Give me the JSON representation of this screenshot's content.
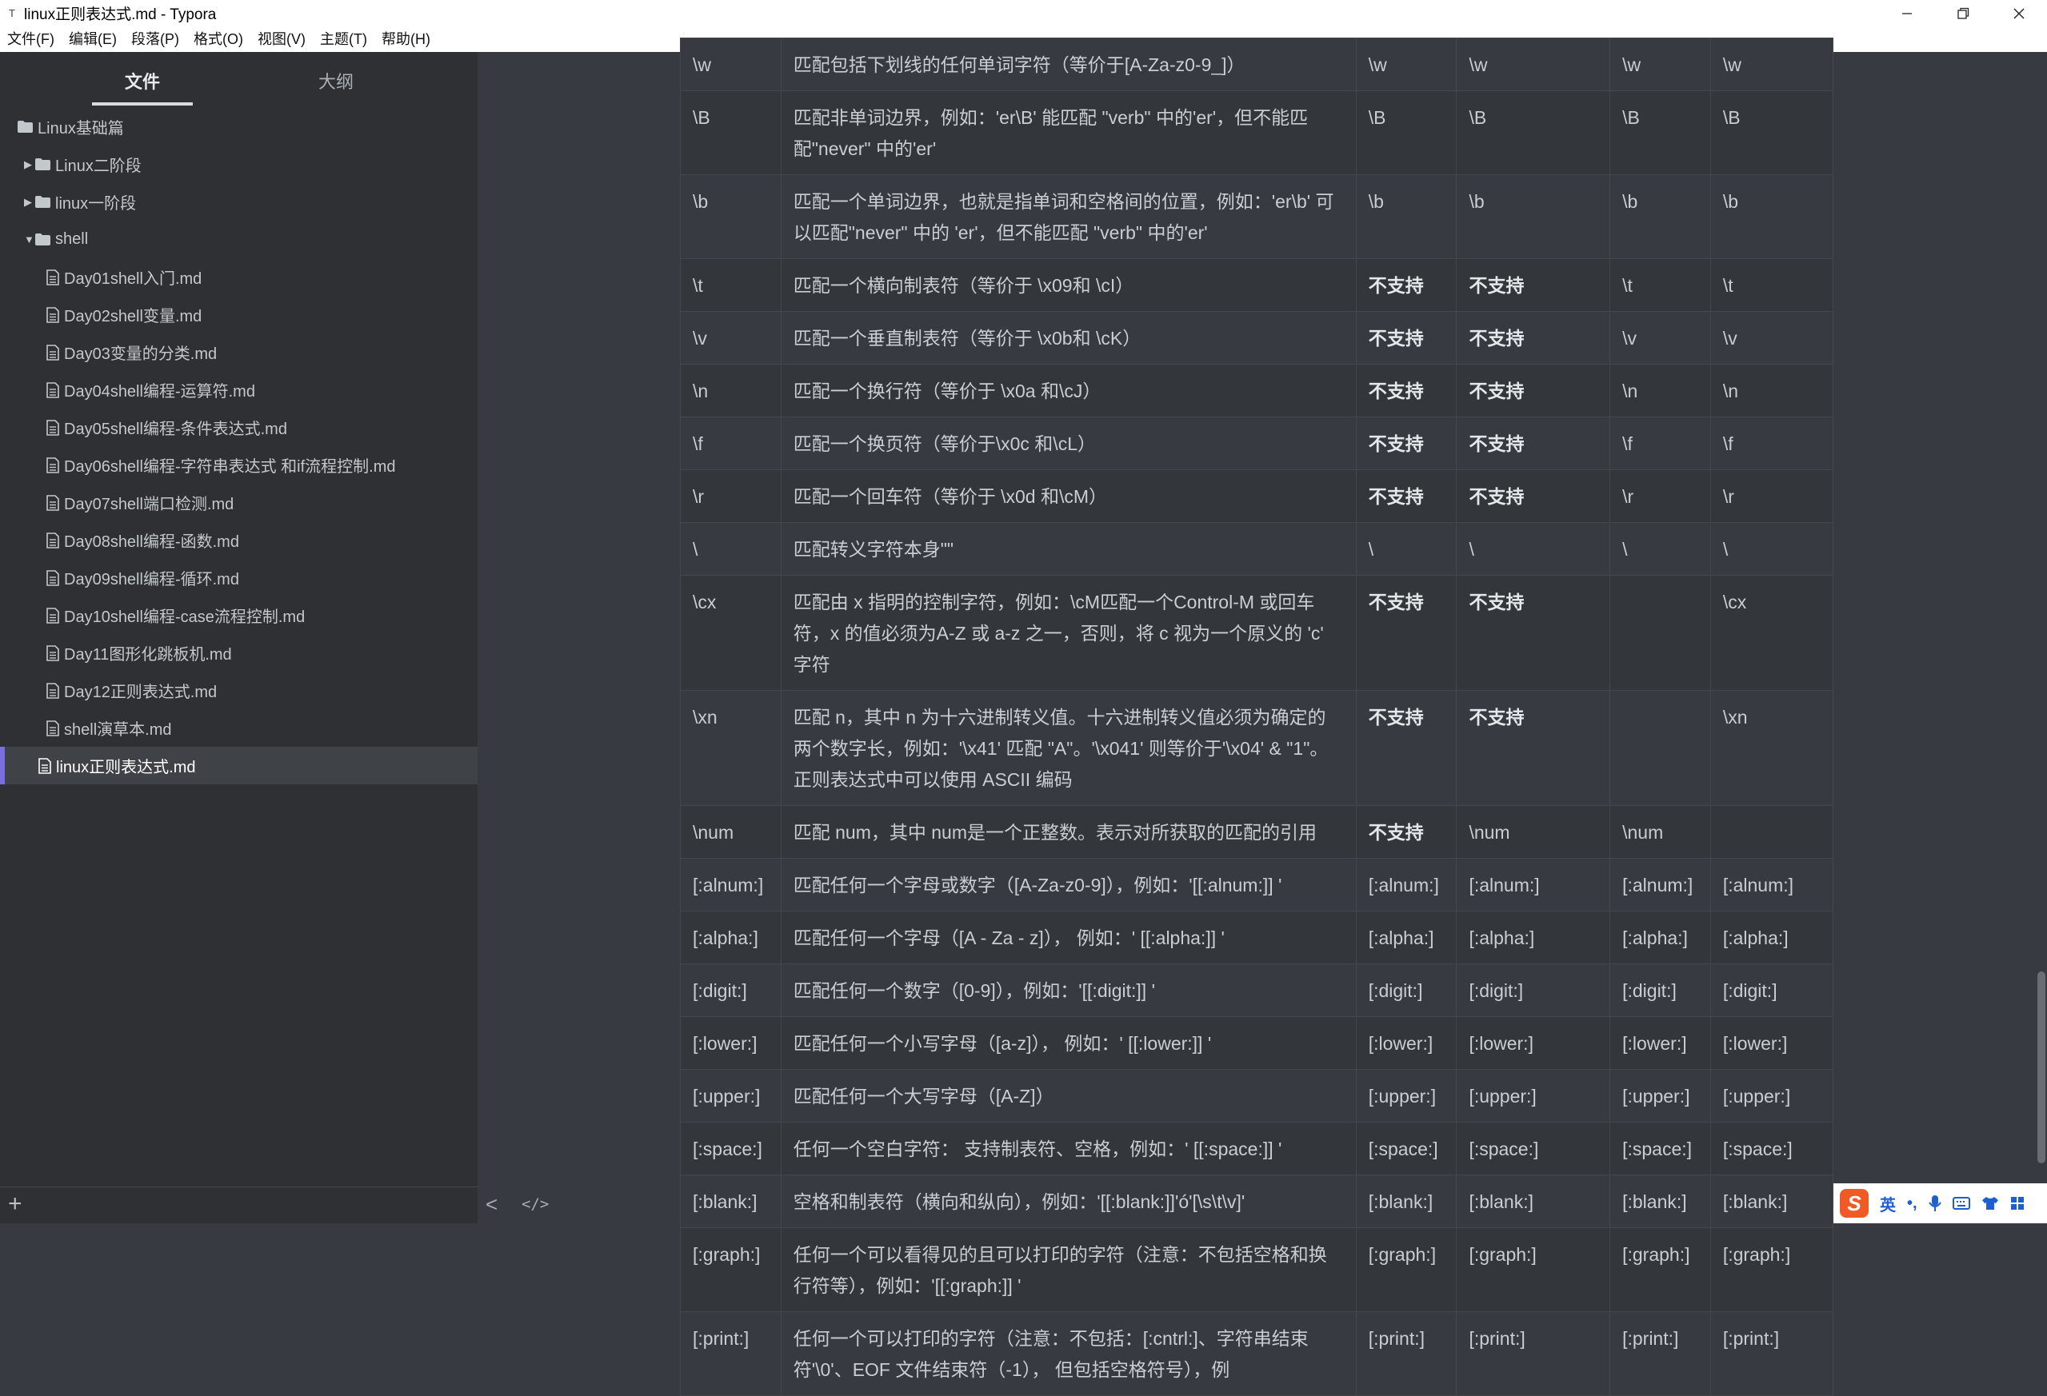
{
  "window": {
    "title": "linux正则表达式.md - Typora",
    "app_icon": "T"
  },
  "menu": [
    "文件(F)",
    "编辑(E)",
    "段落(P)",
    "格式(O)",
    "视图(V)",
    "主题(T)",
    "帮助(H)"
  ],
  "sidebar": {
    "tabs": {
      "files": "文件",
      "outline": "大纲"
    },
    "tree": [
      {
        "label": "Linux基础篇",
        "type": "folder"
      },
      {
        "label": "Linux二阶段",
        "type": "folder",
        "caret": "▶"
      },
      {
        "label": "linux一阶段",
        "type": "folder",
        "caret": "▶"
      },
      {
        "label": "shell",
        "type": "folder",
        "caret": "▼"
      },
      {
        "label": "Day01shell入门.md",
        "type": "file"
      },
      {
        "label": "Day02shell变量.md",
        "type": "file"
      },
      {
        "label": "Day03变量的分类.md",
        "type": "file"
      },
      {
        "label": "Day04shell编程-运算符.md",
        "type": "file"
      },
      {
        "label": "Day05shell编程-条件表达式.md",
        "type": "file"
      },
      {
        "label": "Day06shell编程-字符串表达式 和if流程控制.md",
        "type": "file"
      },
      {
        "label": "Day07shell端口检测.md",
        "type": "file"
      },
      {
        "label": "Day08shell编程-函数.md",
        "type": "file"
      },
      {
        "label": "Day09shell编程-循环.md",
        "type": "file"
      },
      {
        "label": "Day10shell编程-case流程控制.md",
        "type": "file"
      },
      {
        "label": "Day11图形化跳板机.md",
        "type": "file"
      },
      {
        "label": "Day12正则表达式.md",
        "type": "file"
      },
      {
        "label": "shell演草本.md",
        "type": "file"
      },
      {
        "label": "linux正则表达式.md",
        "type": "file",
        "selected": true
      }
    ],
    "add_button": "+"
  },
  "table": {
    "rows": [
      {
        "c1": "\\w",
        "c2": "匹配包括下划线的任何单词字符（等价于[A-Za-z0-9_]）",
        "c3": "\\w",
        "c4": "\\w",
        "c5": "\\w",
        "c6": "\\w"
      },
      {
        "c1": "\\B",
        "c2": "匹配非单词边界，例如：'er\\B' 能匹配 \"verb\" 中的'er'，但不能匹配\"never\" 中的'er'",
        "c3": "\\B",
        "c4": "\\B",
        "c5": "\\B",
        "c6": "\\B"
      },
      {
        "c1": "\\b",
        "c2": "匹配一个单词边界，也就是指单词和空格间的位置，例如：'er\\b' 可以匹配\"never\" 中的 'er'，但不能匹配 \"verb\" 中的'er'",
        "c3": "\\b",
        "c4": "\\b",
        "c5": "\\b",
        "c6": "\\b"
      },
      {
        "c1": "\\t",
        "c2": "匹配一个横向制表符（等价于 \\x09和 \\cI）",
        "c3": "不支持",
        "c4": "不支持",
        "c5": "\\t",
        "c6": "\\t",
        "bold3": true,
        "bold4": true
      },
      {
        "c1": "\\v",
        "c2": "匹配一个垂直制表符（等价于 \\x0b和 \\cK）",
        "c3": "不支持",
        "c4": "不支持",
        "c5": "\\v",
        "c6": "\\v",
        "bold3": true,
        "bold4": true
      },
      {
        "c1": "\\n",
        "c2": "匹配一个换行符（等价于 \\x0a 和\\cJ）",
        "c3": "不支持",
        "c4": "不支持",
        "c5": "\\n",
        "c6": "\\n",
        "bold3": true,
        "bold4": true
      },
      {
        "c1": "\\f",
        "c2": "匹配一个换页符（等价于\\x0c 和\\cL）",
        "c3": "不支持",
        "c4": "不支持",
        "c5": "\\f",
        "c6": "\\f",
        "bold3": true,
        "bold4": true
      },
      {
        "c1": "\\r",
        "c2": "匹配一个回车符（等价于 \\x0d 和\\cM）",
        "c3": "不支持",
        "c4": "不支持",
        "c5": "\\r",
        "c6": "\\r",
        "bold3": true,
        "bold4": true
      },
      {
        "c1": "\\",
        "c2": "匹配转义字符本身\"\"",
        "c3": "\\",
        "c4": "\\",
        "c5": "\\",
        "c6": "\\"
      },
      {
        "c1": "\\cx",
        "c2": "匹配由 x 指明的控制字符，例如：\\cM匹配一个Control-M 或回车符，x 的值必须为A-Z 或 a-z 之一，否则，将 c 视为一个原义的 'c' 字符",
        "c3": "不支持",
        "c4": "不支持",
        "c5": "",
        "c6": "\\cx",
        "bold3": true,
        "bold4": true
      },
      {
        "c1": "\\xn",
        "c2": "匹配 n，其中 n 为十六进制转义值。十六进制转义值必须为确定的两个数字长，例如：'\\x41' 匹配 \"A\"。'\\x041' 则等价于'\\x04' & \"1\"。正则表达式中可以使用 ASCII 编码",
        "c3": "不支持",
        "c4": "不支持",
        "c5": "",
        "c6": "\\xn",
        "bold3": true,
        "bold4": true
      },
      {
        "c1": "\\num",
        "c2": "匹配 num，其中 num是一个正整数。表示对所获取的匹配的引用",
        "c3": "不支持",
        "c4": "\\num",
        "c5": "\\num",
        "c6": "",
        "bold3": true
      },
      {
        "c1": "[:alnum:]",
        "c2": "匹配任何一个字母或数字（[A-Za-z0-9]），例如：'[[:alnum:]] '",
        "c3": "[:alnum:]",
        "c4": "[:alnum:]",
        "c5": "[:alnum:]",
        "c6": "[:alnum:]"
      },
      {
        "c1": "[:alpha:]",
        "c2": "匹配任何一个字母（[A - Za - z]）， 例如：' [[:alpha:]] '",
        "c3": "[:alpha:]",
        "c4": "[:alpha:]",
        "c5": "[:alpha:]",
        "c6": "[:alpha:]"
      },
      {
        "c1": "[:digit:]",
        "c2": "匹配任何一个数字（[0-9]），例如：'[[:digit:]] '",
        "c3": "[:digit:]",
        "c4": "[:digit:]",
        "c5": "[:digit:]",
        "c6": "[:digit:]"
      },
      {
        "c1": "[:lower:]",
        "c2": "匹配任何一个小写字母（[a-z]）， 例如：' [[:lower:]] '",
        "c3": "[:lower:]",
        "c4": "[:lower:]",
        "c5": "[:lower:]",
        "c6": "[:lower:]"
      },
      {
        "c1": "[:upper:]",
        "c2": "匹配任何一个大写字母（[A-Z]）",
        "c3": "[:upper:]",
        "c4": "[:upper:]",
        "c5": "[:upper:]",
        "c6": "[:upper:]"
      },
      {
        "c1": "[:space:]",
        "c2": "任何一个空白字符： 支持制表符、空格，例如：' [[:space:]] '",
        "c3": "[:space:]",
        "c4": "[:space:]",
        "c5": "[:space:]",
        "c6": "[:space:]"
      },
      {
        "c1": "[:blank:]",
        "c2": "空格和制表符（横向和纵向），例如：'[[:blank:]]'ó'[\\s\\t\\v]'",
        "c3": "[:blank:]",
        "c4": "[:blank:]",
        "c5": "[:blank:]",
        "c6": "[:blank:]"
      },
      {
        "c1": "[:graph:]",
        "c2": "任何一个可以看得见的且可以打印的字符（注意：不包括空格和换行符等），例如：'[[:graph:]] '",
        "c3": "[:graph:]",
        "c4": "[:graph:]",
        "c5": "[:graph:]",
        "c6": "[:graph:]"
      },
      {
        "c1": "[:print:]",
        "c2": "任何一个可以打印的字符（注意：不包括：[:cntrl:]、字符串结束符'\\0'、EOF 文件结束符（-1）， 但包括空格符号），例",
        "c3": "[:print:]",
        "c4": "[:print:]",
        "c5": "[:print:]",
        "c6": "[:print:]"
      }
    ]
  },
  "editor_footer": {
    "back": "<",
    "source_toggle": "</>"
  },
  "ime": {
    "logo": "S",
    "lang": "英",
    "punct": "•,",
    "icons": [
      "mic-icon",
      "keyboard-icon",
      "shirt-icon",
      "grid-icon"
    ]
  },
  "colors": {
    "sidebar_bg": "#2e3033",
    "editor_bg": "#373a40",
    "selection_accent": "#7b6ee0",
    "ime_logo": "#f05a24"
  }
}
